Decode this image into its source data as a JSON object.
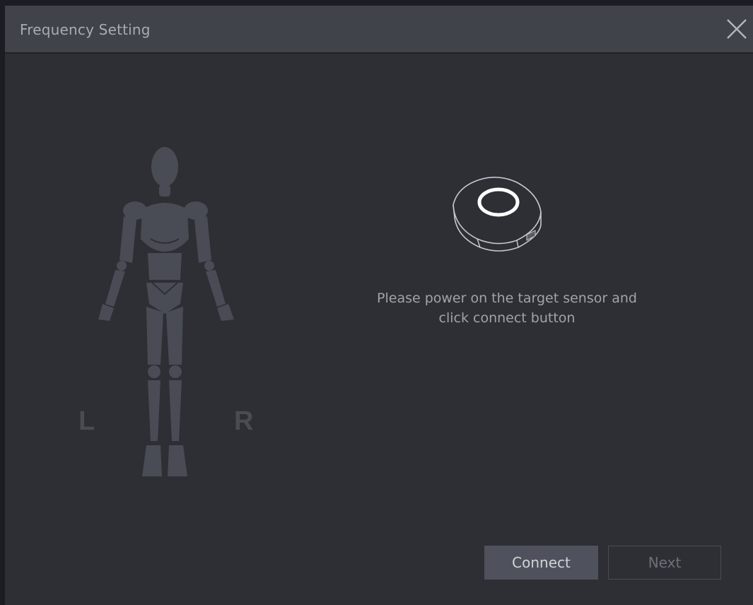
{
  "dialog": {
    "title": "Frequency Setting",
    "close_icon": "close-icon"
  },
  "body_figure": {
    "icon": "human-body-figure-icon",
    "left_label": "L",
    "right_label": "R"
  },
  "sensor": {
    "icon": "sensor-device-icon",
    "ring_color": "#ffffff"
  },
  "instruction": {
    "line1": "Please power on the target sensor and",
    "line2": "click connect button"
  },
  "buttons": {
    "connect_label": "Connect",
    "next_label": "Next"
  },
  "colors": {
    "background": "#2d2f35",
    "titlebar": "#41434b",
    "figure": "#4a4c55",
    "connect_button": "#4f515c"
  }
}
